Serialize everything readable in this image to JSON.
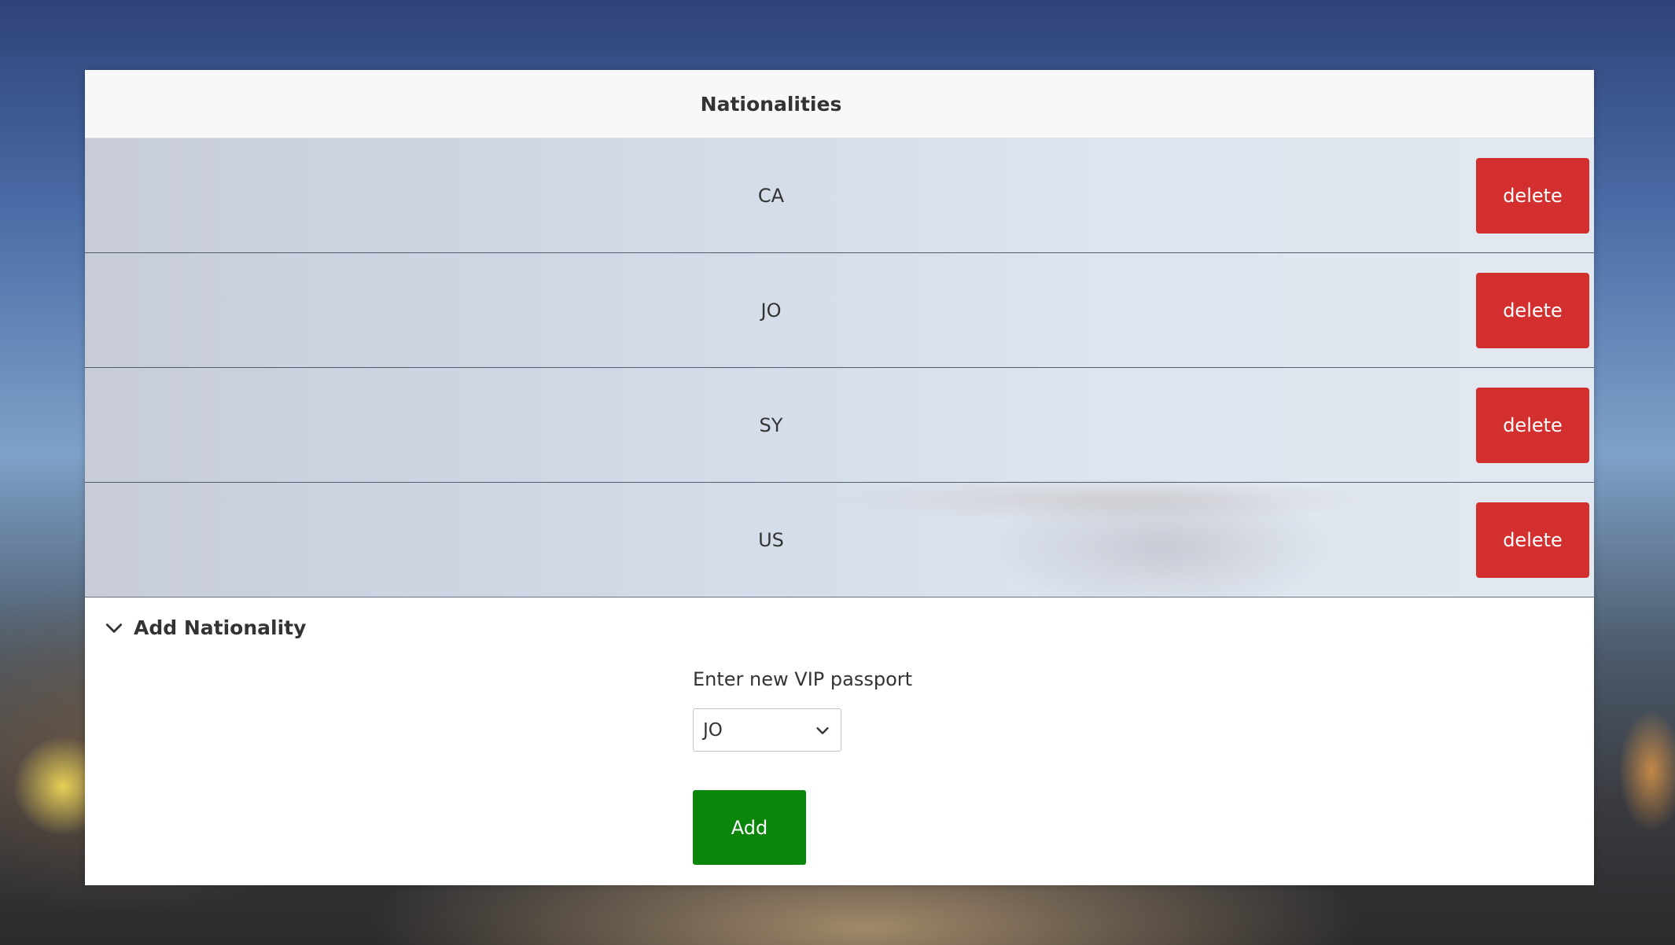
{
  "header": {
    "title": "Nationalities"
  },
  "nationalities": [
    {
      "code": "CA",
      "delete_label": "delete"
    },
    {
      "code": "JO",
      "delete_label": "delete"
    },
    {
      "code": "SY",
      "delete_label": "delete"
    },
    {
      "code": "US",
      "delete_label": "delete"
    }
  ],
  "add_section": {
    "title": "Add Nationality",
    "chevron_icon": "chevron-down-icon",
    "field_label": "Enter new VIP passport",
    "selected_value": "JO",
    "add_label": "Add"
  },
  "colors": {
    "delete": "#d32f2f",
    "add": "#0a870a"
  }
}
